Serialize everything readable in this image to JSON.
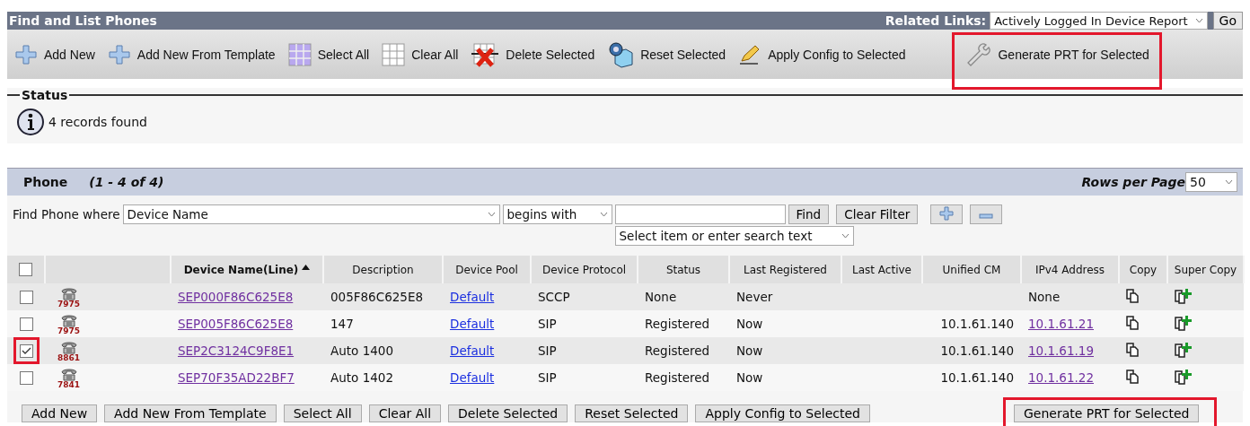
{
  "window": {
    "title": "Find and List Phones"
  },
  "related_links": {
    "label": "Related Links:",
    "value": "Actively Logged In Device Report",
    "go": "Go"
  },
  "toolbar": [
    {
      "label": "Add New",
      "kind": "add",
      "highlighted": false
    },
    {
      "label": "Add New From Template",
      "kind": "add",
      "highlighted": false
    },
    {
      "label": "Select All",
      "kind": "select",
      "highlighted": false
    },
    {
      "label": "Clear All",
      "kind": "clear",
      "highlighted": false
    },
    {
      "label": "Delete Selected",
      "kind": "delete",
      "highlighted": false
    },
    {
      "label": "Reset Selected",
      "kind": "reset",
      "highlighted": false
    },
    {
      "label": "Apply Config to Selected",
      "kind": "apply",
      "highlighted": false
    },
    {
      "label": "Generate PRT for Selected",
      "kind": "wrench",
      "highlighted": true
    }
  ],
  "status": {
    "legend": "Status",
    "message": "4 records found"
  },
  "phone_panel": {
    "title": "Phone",
    "range": "(1 - 4 of 4)",
    "rows_per_page_label": "Rows per Page",
    "rows_per_page": "50"
  },
  "filter": {
    "label": "Find Phone where",
    "field": "Device Name",
    "operator": "begins with",
    "secondary": "Select item or enter search text",
    "find": "Find",
    "clear": "Clear Filter"
  },
  "table": {
    "select_all_checked": false,
    "columns": [
      {
        "label": "Device Name(Line)",
        "sorted": true
      },
      {
        "label": "Description",
        "sorted": false
      },
      {
        "label": "Device Pool",
        "sorted": false
      },
      {
        "label": "Device Protocol",
        "sorted": false
      },
      {
        "label": "Status",
        "sorted": false
      },
      {
        "label": "Last Registered",
        "sorted": false
      },
      {
        "label": "Last Active",
        "sorted": false
      },
      {
        "label": "Unified CM",
        "sorted": false
      },
      {
        "label": "IPv4 Address",
        "sorted": false
      },
      {
        "label": "Copy",
        "sorted": false
      },
      {
        "label": "Super Copy",
        "sorted": false
      }
    ],
    "rows": [
      {
        "checked": false,
        "highlighted": false,
        "model": "7975",
        "device_name": "SEP000F86C625E8",
        "description": "005F86C625E8",
        "device_pool": "Default",
        "protocol": "SCCP",
        "status": "None",
        "last_registered": "Never",
        "ipv4": "None",
        "ipv4_link": false
      },
      {
        "checked": false,
        "highlighted": false,
        "model": "7975",
        "device_name": "SEP005F86C625E8",
        "description": "147",
        "device_pool": "Default",
        "protocol": "SIP",
        "status": "Registered",
        "last_registered": "Now",
        "unified_cm": "10.1.61.140",
        "ipv4": "10.1.61.21",
        "ipv4_link": true
      },
      {
        "checked": true,
        "highlighted": true,
        "model": "8861",
        "device_name": "SEP2C3124C9F8E1",
        "description": "Auto 1400",
        "device_pool": "Default",
        "protocol": "SIP",
        "status": "Registered",
        "last_registered": "Now",
        "unified_cm": "10.1.61.140",
        "ipv4": "10.1.61.19",
        "ipv4_link": true
      },
      {
        "checked": false,
        "highlighted": false,
        "model": "7841",
        "device_name": "SEP70F35AD22BF7",
        "description": "Auto 1402",
        "device_pool": "Default",
        "protocol": "SIP",
        "status": "Registered",
        "last_registered": "Now",
        "unified_cm": "10.1.61.140",
        "ipv4": "10.1.61.22",
        "ipv4_link": true
      }
    ]
  },
  "bottom_buttons": [
    {
      "label": "Add New",
      "highlighted": false
    },
    {
      "label": "Add New From Template",
      "highlighted": false
    },
    {
      "label": "Select All",
      "highlighted": false
    },
    {
      "label": "Clear All",
      "highlighted": false
    },
    {
      "label": "Delete Selected",
      "highlighted": false
    },
    {
      "label": "Reset Selected",
      "highlighted": false
    },
    {
      "label": "Apply Config to Selected",
      "highlighted": false
    },
    {
      "label": "Generate PRT for Selected",
      "highlighted": true
    }
  ]
}
